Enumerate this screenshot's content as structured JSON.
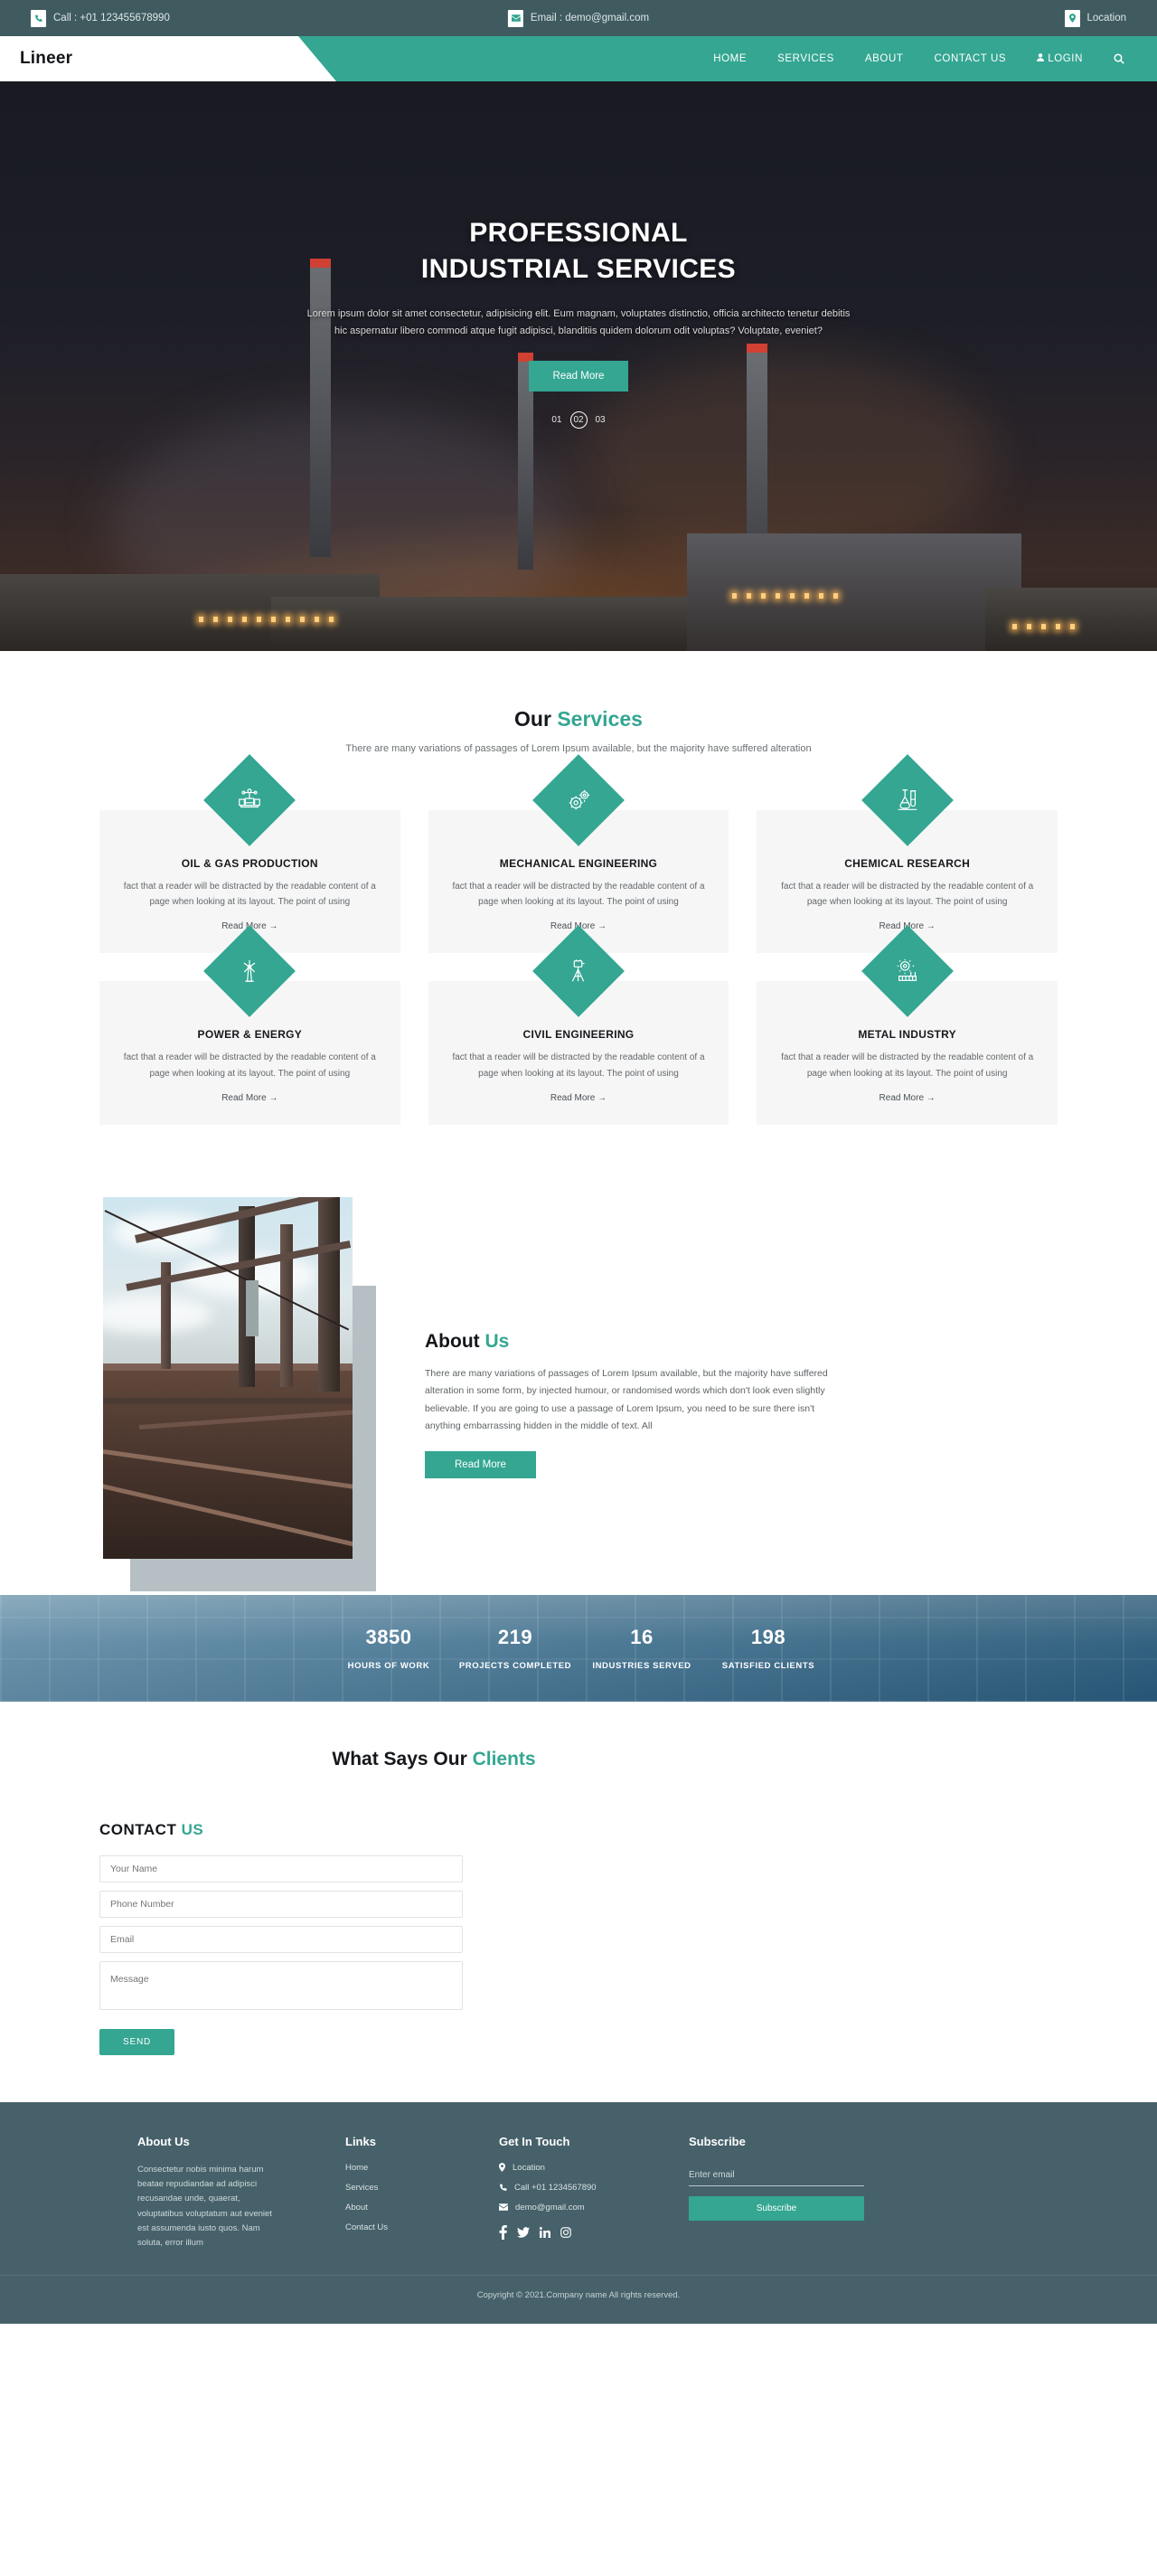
{
  "topbar": {
    "phone": "Call : +01 123455678990",
    "email": "Email : demo@gmail.com",
    "location": "Location"
  },
  "nav": {
    "brand": "Lineer",
    "links": [
      {
        "label": "HOME"
      },
      {
        "label": "SERVICES"
      },
      {
        "label": "ABOUT"
      },
      {
        "label": "CONTACT US"
      },
      {
        "label": "LOGIN"
      }
    ],
    "search_icon": "search-icon"
  },
  "hero": {
    "title_line1": "PROFESSIONAL",
    "title_line2": "INDUSTRIAL SERVICES",
    "paragraph": "Lorem ipsum dolor sit amet consectetur, adipisicing elit. Eum magnam, voluptates distinctio, officia architecto tenetur debitis hic aspernatur libero commodi atque fugit adipisci, blanditiis quidem dolorum odit voluptas? Voluptate, eveniet?",
    "button": "Read More",
    "slides": [
      "01",
      "02",
      "03"
    ],
    "active_slide": "02"
  },
  "services": {
    "title_main": "Our ",
    "title_accent": "Services",
    "subtitle": "There are many variations of passages of Lorem Ipsum available, but the majority have suffered alteration",
    "body_text": "fact that a reader will be distracted by the readable content of a page when looking at its layout. The point of using",
    "read_more": "Read More →",
    "items": [
      {
        "title": "OIL & GAS PRODUCTION",
        "icon": "valve-icon"
      },
      {
        "title": "MECHANICAL ENGINEERING",
        "icon": "gears-icon"
      },
      {
        "title": "CHEMICAL RESEARCH",
        "icon": "flask-icon"
      },
      {
        "title": "POWER & ENERGY",
        "icon": "wind-turbine-icon"
      },
      {
        "title": "CIVIL ENGINEERING",
        "icon": "surveying-tripod-icon"
      },
      {
        "title": "METAL INDUSTRY",
        "icon": "gear-factory-icon"
      }
    ]
  },
  "about": {
    "title_main": "About ",
    "title_accent": "Us",
    "paragraph": "There are many variations of passages of Lorem Ipsum available, but the majority have suffered alteration in some form, by injected humour, or randomised words which don't look even slightly believable. If you are going to use a passage of Lorem Ipsum, you need to be sure there isn't anything embarrassing hidden in the middle of text. All",
    "button": "Read More",
    "image_alt": "industrial-plant-photo"
  },
  "stats": [
    {
      "number": "3850",
      "label": "HOURS OF WORK"
    },
    {
      "number": "219",
      "label": "PROJECTS COMPLETED"
    },
    {
      "number": "16",
      "label": "INDUSTRIES SERVED"
    },
    {
      "number": "198",
      "label": "SATISFIED CLIENTS"
    }
  ],
  "testimonials": {
    "title_main": "What Says Our ",
    "title_accent": "Clients"
  },
  "contact": {
    "title_main": "CONTACT ",
    "title_accent": "US",
    "name_placeholder": "Your Name",
    "phone_placeholder": "Phone Number",
    "email_placeholder": "Email",
    "message_placeholder": "Message",
    "send_label": "SEND"
  },
  "footer": {
    "about": {
      "heading": "About Us",
      "text": "Consectetur nobis minima harum beatae repudiandae ad adipisci recusandae unde, quaerat, voluptatibus voluptatum aut eveniet est assumenda iusto quos. Nam soluta, error illum"
    },
    "links": {
      "heading": "Links",
      "items": [
        {
          "label": "Home"
        },
        {
          "label": "Services"
        },
        {
          "label": "About"
        },
        {
          "label": "Contact Us"
        }
      ]
    },
    "touch": {
      "heading": "Get In Touch",
      "location": "Location",
      "phone": "Call +01 1234567890",
      "email": "demo@gmail.com",
      "socials": [
        "facebook-icon",
        "twitter-icon",
        "linkedin-icon",
        "instagram-icon"
      ]
    },
    "subscribe": {
      "heading": "Subscribe",
      "placeholder": "Enter email",
      "button": "Subscribe"
    },
    "copyright": "Copyright © 2021.Company name All rights reserved."
  },
  "colors": {
    "teal": "#34a692",
    "dark_slate": "#3f5b60",
    "footer": "#46616a"
  }
}
